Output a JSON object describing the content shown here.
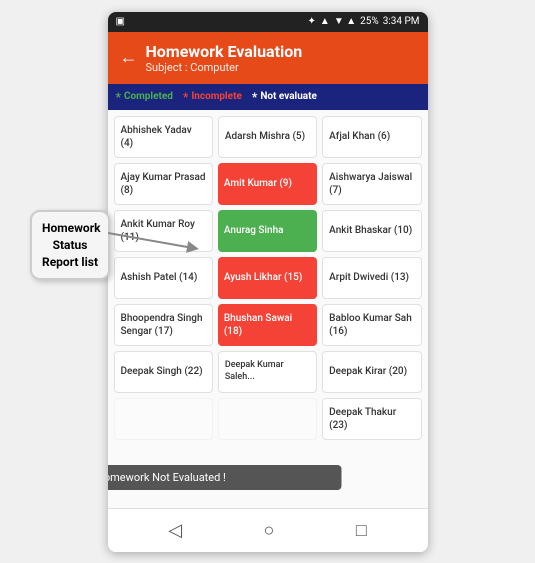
{
  "statusBar": {
    "left": "▣",
    "bluetooth": "⚡",
    "battery": "25%",
    "time": "3:34 PM"
  },
  "header": {
    "title": "Homework Evaluation",
    "subtitle": "Subject : Computer",
    "backIcon": "←"
  },
  "legend": {
    "completedLabel": "Completed",
    "incompleteLabel": "Incomplete",
    "notEvaluateLabel": "Not evaluate",
    "starIcon": "*"
  },
  "labelBox": {
    "text": "Homework\nStatus\nReport list"
  },
  "students": [
    {
      "name": "Abhishek Yadav (4)",
      "type": "white"
    },
    {
      "name": "Adarsh Mishra (5)",
      "type": "white"
    },
    {
      "name": "Afjal Khan (6)",
      "type": "white"
    },
    {
      "name": "Ajay Kumar Prasad (8)",
      "type": "white"
    },
    {
      "name": "Amit Kumar (9)",
      "type": "red"
    },
    {
      "name": "Aishwarya Jaiswal (7)",
      "type": "white"
    },
    {
      "name": "Ankit Kumar Roy (11)",
      "type": "white"
    },
    {
      "name": "Anurag Sinha",
      "type": "green"
    },
    {
      "name": "Ankit Bhaskar (10)",
      "type": "white"
    },
    {
      "name": "Ashish Patel (14)",
      "type": "white"
    },
    {
      "name": "Ayush Likhar (15)",
      "type": "red"
    },
    {
      "name": "Arpit Dwivedi (13)",
      "type": "white"
    },
    {
      "name": "Bhoopendra Singh Sengar (17)",
      "type": "white"
    },
    {
      "name": "Bhushan Sawai (18)",
      "type": "red"
    },
    {
      "name": "Babloo Kumar Sah (16)",
      "type": "white"
    },
    {
      "name": "Deepak Singh (22)",
      "type": "white"
    },
    {
      "name": "",
      "type": "white"
    },
    {
      "name": "Deepak Kirar (20)",
      "type": "white"
    },
    {
      "name": "",
      "type": "white"
    },
    {
      "name": "",
      "type": "white"
    },
    {
      "name": "Deepak Thakur (23)",
      "type": "white"
    }
  ],
  "tooltip": "Homework Not Evaluated !",
  "navbar": {
    "back": "◁",
    "home": "○",
    "menu": "□"
  }
}
